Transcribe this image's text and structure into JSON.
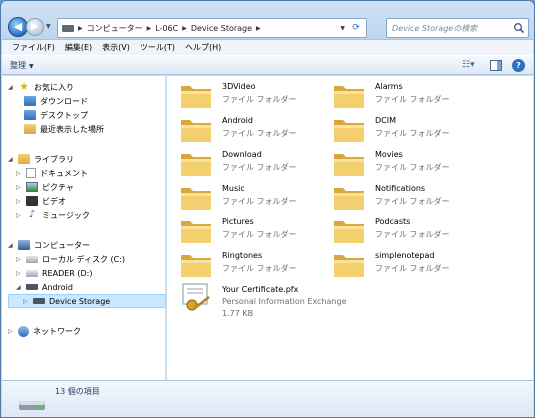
{
  "address": {
    "crumbs": [
      "コンピューター",
      "L-06C",
      "Device Storage"
    ],
    "search_placeholder": "Device Storageの検索"
  },
  "menu": [
    "ファイル(F)",
    "編集(E)",
    "表示(V)",
    "ツール(T)",
    "ヘルプ(H)"
  ],
  "toolbar": {
    "organize_label": "整理"
  },
  "navigation": {
    "favorites": {
      "label": "お気に入り",
      "items": [
        "ダウンロード",
        "デスクトップ",
        "最近表示した場所"
      ]
    },
    "libraries": {
      "label": "ライブラリ",
      "items": [
        "ドキュメント",
        "ピクチャ",
        "ビデオ",
        "ミュージック"
      ]
    },
    "computer": {
      "label": "コンピューター",
      "items": [
        "ローカル ディスク (C:)",
        "READER (D:)",
        "Android",
        "Device Storage"
      ]
    },
    "network": {
      "label": "ネットワーク"
    }
  },
  "files": [
    {
      "name": "3DVideo",
      "type": "ファイル フォルダー",
      "kind": "folder"
    },
    {
      "name": "Alarms",
      "type": "ファイル フォルダー",
      "kind": "folder"
    },
    {
      "name": "Android",
      "type": "ファイル フォルダー",
      "kind": "folder"
    },
    {
      "name": "DCIM",
      "type": "ファイル フォルダー",
      "kind": "folder"
    },
    {
      "name": "Download",
      "type": "ファイル フォルダー",
      "kind": "folder"
    },
    {
      "name": "Movies",
      "type": "ファイル フォルダー",
      "kind": "folder"
    },
    {
      "name": "Music",
      "type": "ファイル フォルダー",
      "kind": "folder"
    },
    {
      "name": "Notifications",
      "type": "ファイル フォルダー",
      "kind": "folder"
    },
    {
      "name": "Pictures",
      "type": "ファイル フォルダー",
      "kind": "folder"
    },
    {
      "name": "Podcasts",
      "type": "ファイル フォルダー",
      "kind": "folder"
    },
    {
      "name": "Ringtones",
      "type": "ファイル フォルダー",
      "kind": "folder"
    },
    {
      "name": "simplenotepad",
      "type": "ファイル フォルダー",
      "kind": "folder"
    },
    {
      "name": "Your Certificate.pfx",
      "type": "Personal Information Exchange",
      "size": "1.77 KB",
      "kind": "certificate"
    }
  ],
  "status": {
    "item_count": "13 個の項目"
  }
}
